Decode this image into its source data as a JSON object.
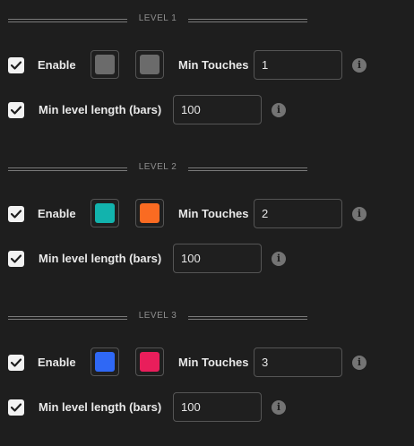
{
  "levels": [
    {
      "title": "LEVEL 1",
      "enable_label": "Enable",
      "enabled": true,
      "color_1": "#6b6b6b",
      "color_2": "#6b6b6b",
      "min_touches_label": "Min Touches",
      "min_touches": "1",
      "min_length_label": "Min level length (bars)",
      "min_length": "100",
      "min_length_enabled": true
    },
    {
      "title": "LEVEL 2",
      "enable_label": "Enable",
      "enabled": true,
      "color_1": "#12b3ad",
      "color_2": "#fa6b22",
      "min_touches_label": "Min Touches",
      "min_touches": "2",
      "min_length_label": "Min level length (bars)",
      "min_length": "100",
      "min_length_enabled": true
    },
    {
      "title": "LEVEL 3",
      "enable_label": "Enable",
      "enabled": true,
      "color_1": "#2f68f5",
      "color_2": "#e91e5b",
      "min_touches_label": "Min Touches",
      "min_touches": "3",
      "min_length_label": "Min level length (bars)",
      "min_length": "100",
      "min_length_enabled": true
    }
  ],
  "icons": {
    "checkbox": "checkmark-icon",
    "info": "info-icon"
  }
}
